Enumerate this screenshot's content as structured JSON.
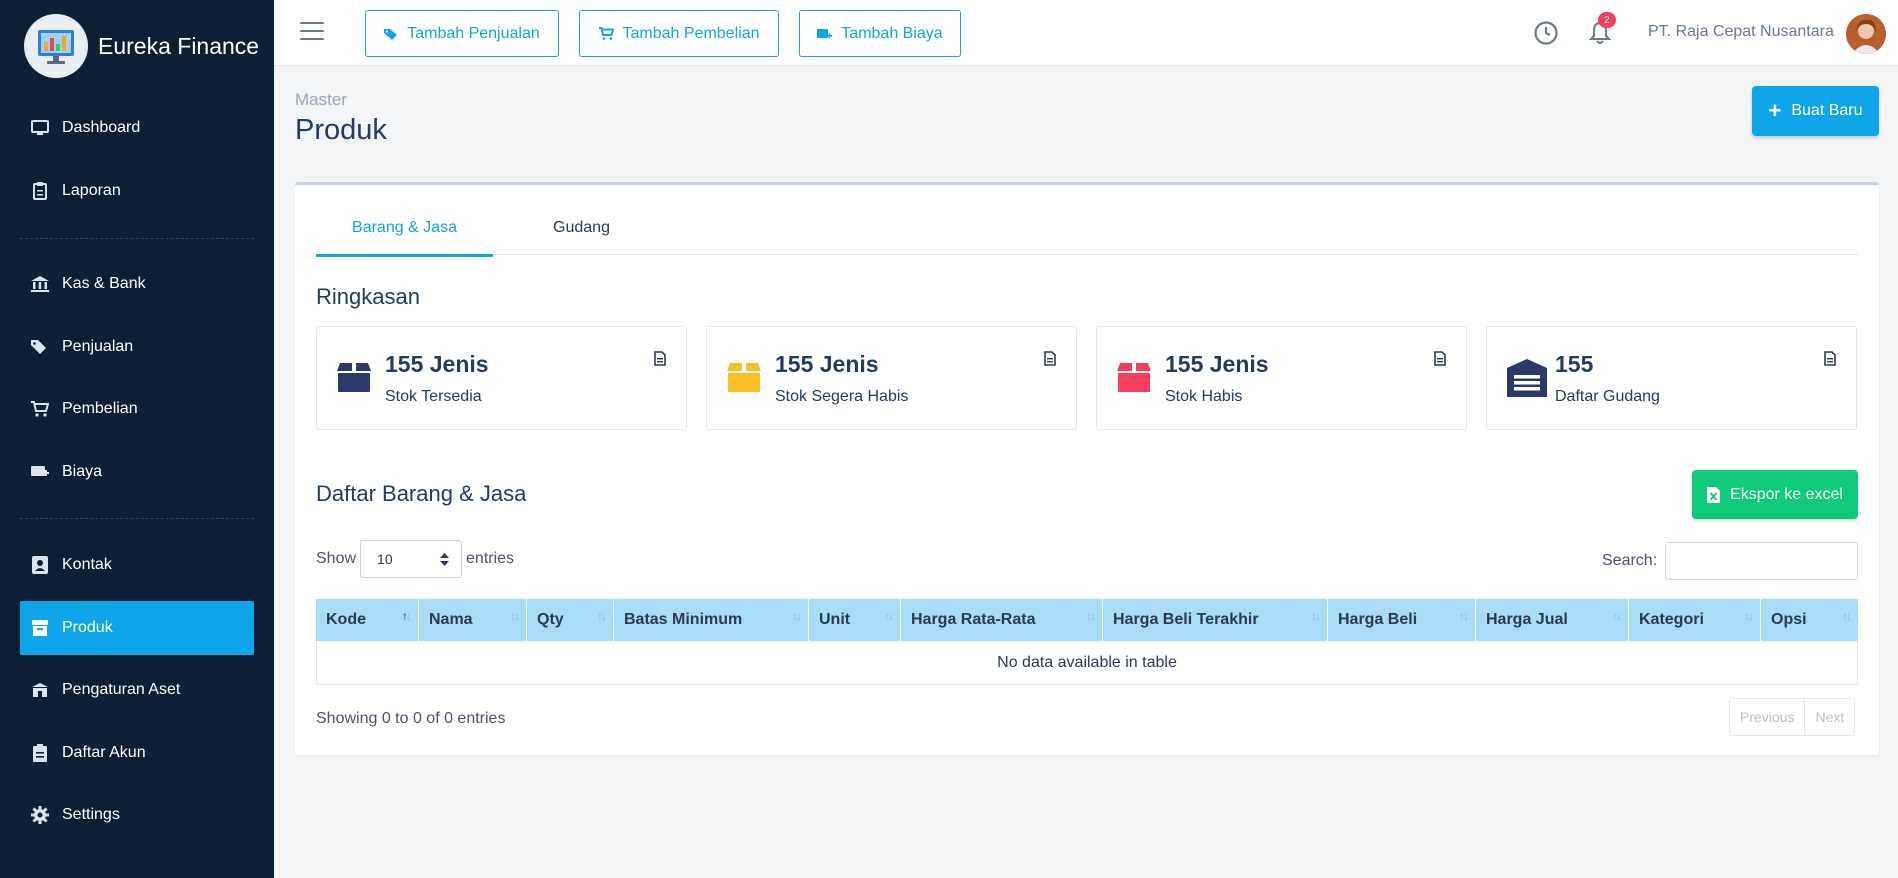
{
  "brand": {
    "name": "Eureka Finance",
    "logo_icon": "monitor-chart-icon"
  },
  "sidebar": {
    "items": [
      {
        "label": "Dashboard",
        "icon": "monitor-icon"
      },
      {
        "label": "Laporan",
        "icon": "clipboard-icon"
      },
      {
        "label": "Kas & Bank",
        "icon": "bank-icon"
      },
      {
        "label": "Penjualan",
        "icon": "tags-icon"
      },
      {
        "label": "Pembelian",
        "icon": "cart-icon"
      },
      {
        "label": "Biaya",
        "icon": "money-plus-icon"
      },
      {
        "label": "Kontak",
        "icon": "contact-card-icon"
      },
      {
        "label": "Produk",
        "icon": "box-icon",
        "active": true
      },
      {
        "label": "Pengaturan Aset",
        "icon": "building-icon"
      },
      {
        "label": "Daftar Akun",
        "icon": "list-clipboard-icon"
      },
      {
        "label": "Settings",
        "icon": "gear-icon"
      }
    ]
  },
  "header": {
    "buttons": [
      {
        "label": "Tambah Penjualan",
        "icon": "tag-icon"
      },
      {
        "label": "Tambah Pembelian",
        "icon": "cart-icon"
      },
      {
        "label": "Tambah Biaya",
        "icon": "money-plus-icon"
      }
    ],
    "notification_count": "2",
    "company": "PT. Raja Cepat Nusantara"
  },
  "page": {
    "breadcrumb": "Master",
    "title": "Produk",
    "new_button": "Buat Baru"
  },
  "tabs": [
    {
      "label": "Barang & Jasa",
      "active": true
    },
    {
      "label": "Gudang",
      "active": false
    }
  ],
  "summary": {
    "title": "Ringkasan",
    "cards": [
      {
        "value": "155 Jenis",
        "label": "Stok Tersedia",
        "color": "#2b3a6b"
      },
      {
        "value": "155 Jenis",
        "label": "Stok Segera Habis",
        "color": "#fbbf24"
      },
      {
        "value": "155 Jenis",
        "label": "Stok Habis",
        "color": "#f43f5e"
      },
      {
        "value": "155",
        "label": "Daftar Gudang",
        "color": "#2b3a6b"
      }
    ]
  },
  "list": {
    "title": "Daftar Barang & Jasa",
    "export_button": "Ekspor ke excel",
    "show_label": "Show",
    "entries_value": "10",
    "entries_label": "entries",
    "search_label": "Search:",
    "columns": [
      "Kode",
      "Nama",
      "Qty",
      "Batas Minimum",
      "Unit",
      "Harga Rata-Rata",
      "Harga Beli Terakhir",
      "Harga Beli",
      "Harga Jual",
      "Kategori",
      "Opsi"
    ],
    "empty_message": "No data available in table",
    "info": "Showing 0 to 0 of 0 entries",
    "prev": "Previous",
    "next": "Next"
  },
  "colors": {
    "accent": "#0ea5e9",
    "sidebar_bg": "#0d1f35",
    "success": "#10c97a"
  }
}
